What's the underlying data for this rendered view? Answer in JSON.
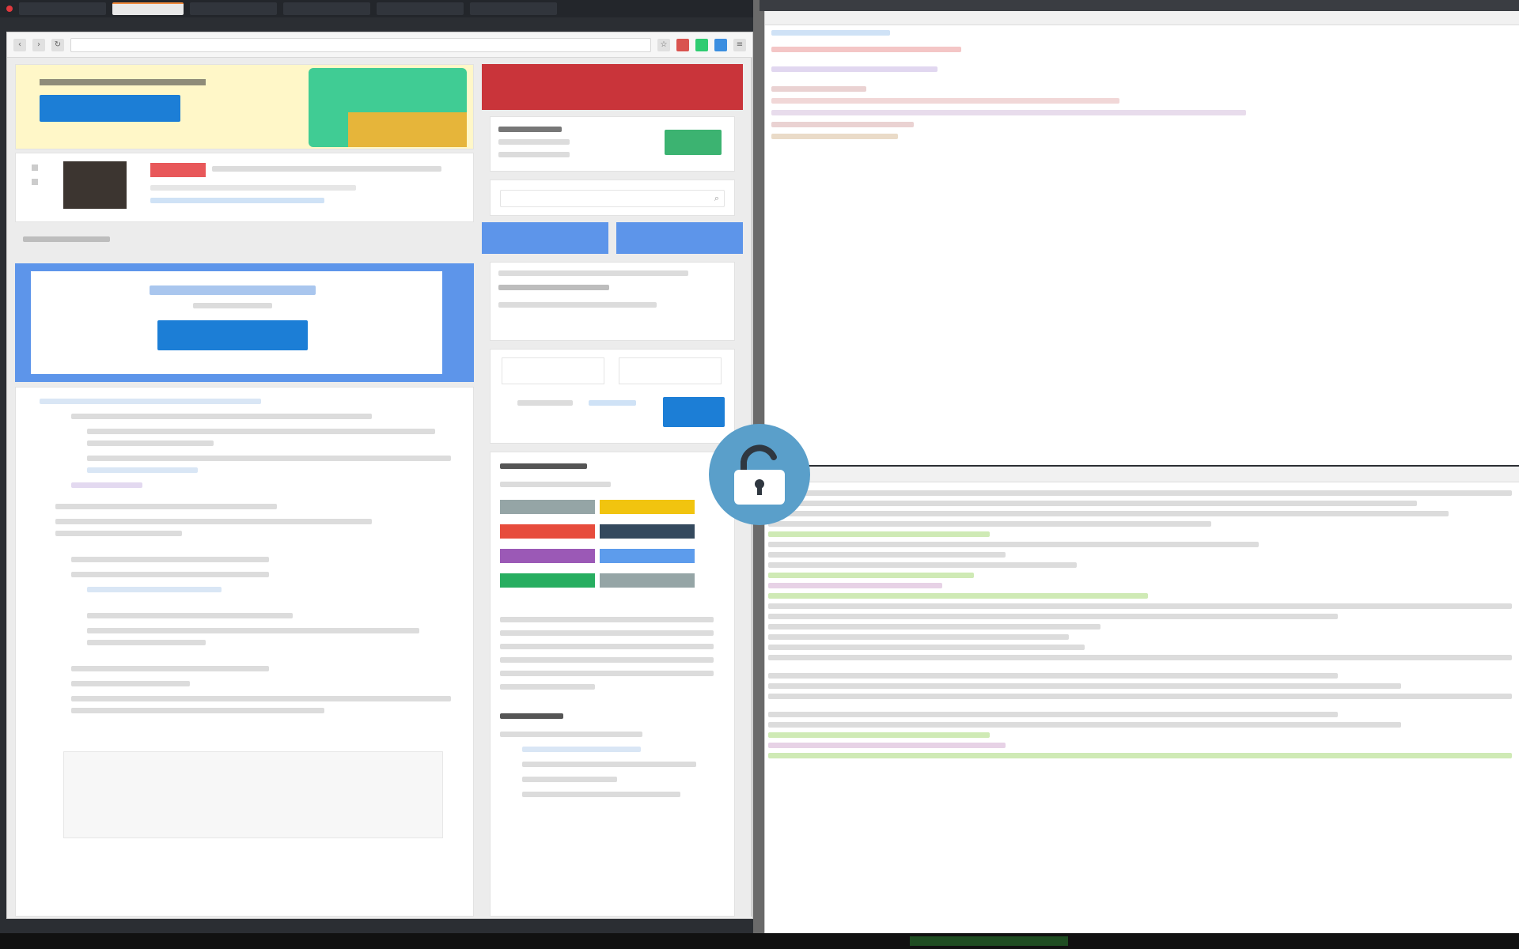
{
  "taskbar": {
    "apps": [
      "",
      "",
      "",
      "",
      "",
      ""
    ]
  },
  "browser": {
    "url": "",
    "ad_banner": {
      "heading": "",
      "button": ""
    },
    "video_item": {
      "badge": "",
      "title": "",
      "meta": ""
    },
    "section_title": "",
    "promo": {
      "title": "",
      "subtitle": "",
      "button": ""
    },
    "sidebar": {
      "profile_name": "",
      "follow_button": "",
      "search_placeholder": "",
      "btn_left": "",
      "btn_right": "",
      "login_button": "",
      "tags_heading": "",
      "tag_colors": [
        "#95a5a6",
        "#f1c40f",
        "#e74c3c",
        "#34495e",
        "#9b59b6",
        "#5d9cec",
        "#27ae60",
        "#95a5a6"
      ],
      "list_heading": ""
    }
  },
  "editor": {
    "title": "",
    "path": ""
  },
  "terminal": {
    "title": ""
  },
  "icons": {
    "lock": "unlock-icon"
  }
}
